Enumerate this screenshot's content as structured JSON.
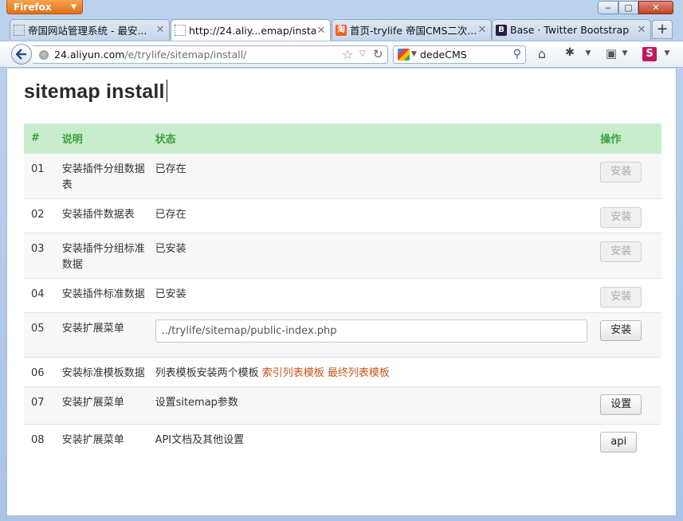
{
  "browser": {
    "app_button": "Firefox",
    "tabs": [
      {
        "title": "帝国网站管理系统 - 最安...",
        "icon": "blank-page-icon",
        "active": false
      },
      {
        "title": "http://24.aliy...emap/install/",
        "icon": "blank-page-icon",
        "active": true
      },
      {
        "title": "首页-trylife 帝国CMS二次...",
        "icon": "taobao-icon",
        "active": false
      },
      {
        "title": "Base · Twitter Bootstrap",
        "icon": "bootstrap-icon",
        "active": false
      }
    ],
    "tab_close": "✕",
    "new_tab": "+",
    "url_domain": "24.aliyun.com",
    "url_path": "/e/trylife/sitemap/install/",
    "search_value": "dedeCMS",
    "favicon_letters": {
      "taobao": "淘",
      "bootstrap": "B",
      "s": "S"
    }
  },
  "page": {
    "title": "sitemap install",
    "headers": {
      "num": "#",
      "desc": "说明",
      "status": "状态",
      "op": "操作"
    },
    "rows": [
      {
        "num": "01",
        "desc": "安装插件分组数据表",
        "status": "已存在",
        "op": "安装"
      },
      {
        "num": "02",
        "desc": "安装插件数据表",
        "status": "已存在",
        "op": "安装"
      },
      {
        "num": "03",
        "desc": "安装插件分组标准数据",
        "status": "已安装",
        "op": "安装"
      },
      {
        "num": "04",
        "desc": "安装插件标准数据",
        "status": "已安装",
        "op": "安装"
      },
      {
        "num": "05",
        "desc": "安装扩展菜单",
        "input_value": "../trylife/sitemap/public-index.php",
        "op": "安装"
      },
      {
        "num": "06",
        "desc": "安装标准模板数据",
        "status_prefix": "列表模板安装两个模板",
        "link1": "索引列表模板",
        "link2": "最终列表模板"
      },
      {
        "num": "07",
        "desc": "安装扩展菜单",
        "status": "设置sitemap参数",
        "op": "设置"
      },
      {
        "num": "08",
        "desc": "安装扩展菜单",
        "status": "API文档及其他设置",
        "op": "api"
      }
    ]
  }
}
